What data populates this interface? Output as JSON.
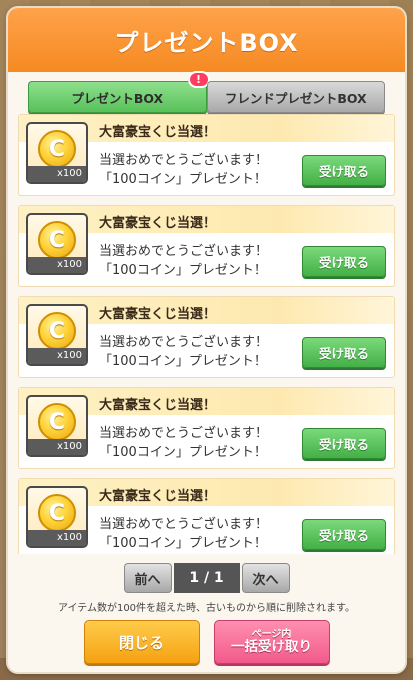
{
  "dialog": {
    "title": "プレゼントBOX"
  },
  "tabs": [
    {
      "label": "プレゼントBOX",
      "badge": "!"
    },
    {
      "label": "フレンドプレゼントBOX"
    }
  ],
  "items": [
    {
      "title": "大富豪宝くじ当選！",
      "line1": "当選おめでとうございます！",
      "line2": "「100コイン」プレゼント！",
      "qty": "x100",
      "coin_glyph": "C",
      "claim_label": "受け取る"
    },
    {
      "title": "大富豪宝くじ当選！",
      "line1": "当選おめでとうございます！",
      "line2": "「100コイン」プレゼント！",
      "qty": "x100",
      "coin_glyph": "C",
      "claim_label": "受け取る"
    },
    {
      "title": "大富豪宝くじ当選！",
      "line1": "当選おめでとうございます！",
      "line2": "「100コイン」プレゼント！",
      "qty": "x100",
      "coin_glyph": "C",
      "claim_label": "受け取る"
    },
    {
      "title": "大富豪宝くじ当選！",
      "line1": "当選おめでとうございます！",
      "line2": "「100コイン」プレゼント！",
      "qty": "x100",
      "coin_glyph": "C",
      "claim_label": "受け取る"
    },
    {
      "title": "大富豪宝くじ当選！",
      "line1": "当選おめでとうございます！",
      "line2": "「100コイン」プレゼント！",
      "qty": "x100",
      "coin_glyph": "C",
      "claim_label": "受け取る"
    }
  ],
  "pager": {
    "prev_label": "前へ",
    "page_text": "1 / 1",
    "next_label": "次へ"
  },
  "notice": "アイテム数が100件を超えた時、古いものから順に削除されます。",
  "footer": {
    "close_label": "閉じる",
    "claim_all_small": "ページ内",
    "claim_all_big": "一括受け取り"
  },
  "colors": {
    "header": "#f58a22",
    "claim_button": "#43b046",
    "close_button": "#f5a112",
    "claim_all_button": "#f25a8b"
  },
  "icons": [
    "coin-icon",
    "home-icon",
    "copyright-icon"
  ]
}
